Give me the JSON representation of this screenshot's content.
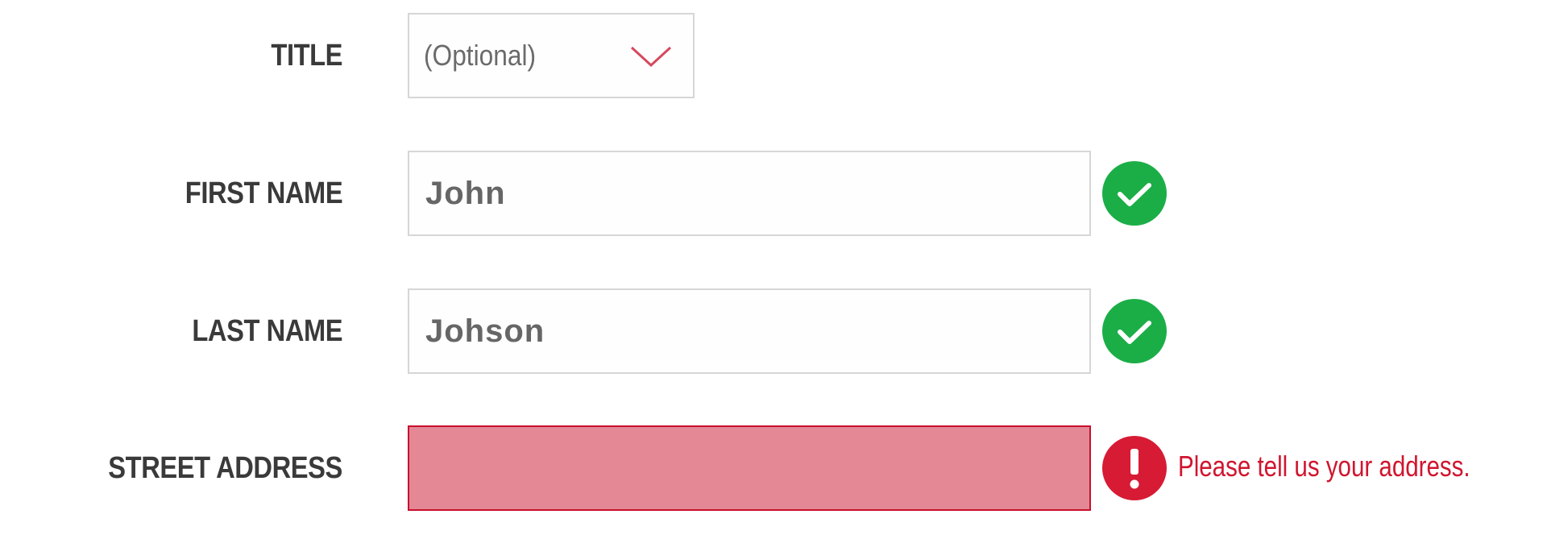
{
  "colors": {
    "valid_green": "#1bae47",
    "error_red": "#d71b35",
    "error_field_fill": "#e48896",
    "label_text": "#3a3a3a",
    "chevron": "#d6485e"
  },
  "form": {
    "title": {
      "label": "TITLE",
      "selected": "(Optional)",
      "icon": "chevron-down-icon"
    },
    "first_name": {
      "label": "FIRST NAME",
      "value": "John",
      "status_icon": "checkmark-icon"
    },
    "last_name": {
      "label": "LAST NAME",
      "value": "Johson",
      "status_icon": "checkmark-icon"
    },
    "street_address": {
      "label": "STREET ADDRESS",
      "value": "",
      "status_icon": "exclamation-icon",
      "error_message": "Please tell us your address."
    }
  }
}
